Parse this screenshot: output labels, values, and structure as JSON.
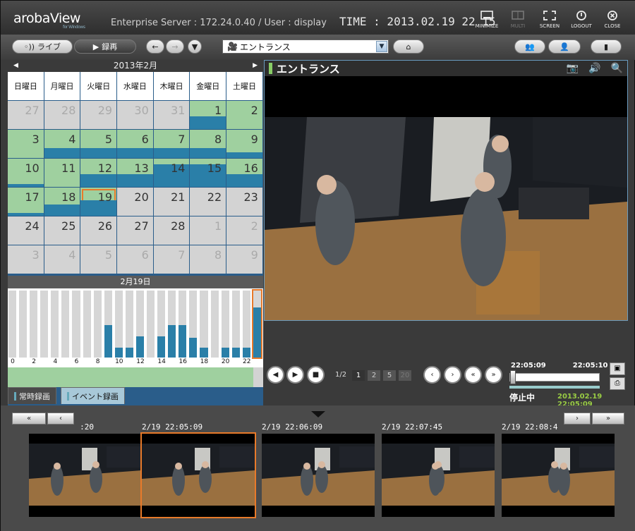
{
  "header": {
    "logo": "arobaView",
    "logo_sub": "for Windows",
    "server": "Enterprise Server : 172.24.0.40  /  User : display",
    "time": "TIME : 2013.02.19 22 15",
    "buttons": [
      {
        "label": "MINIMIZE",
        "icon": "minimize-icon",
        "enabled": true
      },
      {
        "label": "MULTI",
        "icon": "multi-icon",
        "enabled": false
      },
      {
        "label": "SCREEN",
        "icon": "fullscreen-icon",
        "enabled": true
      },
      {
        "label": "LOGOUT",
        "icon": "power-icon",
        "enabled": true
      },
      {
        "label": "CLOSE",
        "icon": "close-icon",
        "enabled": true
      }
    ]
  },
  "toolbar": {
    "live_label": "ライブ",
    "record_label": "録再",
    "camera_selected": "エントランス"
  },
  "calendar": {
    "month": "2013年2月",
    "dow": [
      "日曜日",
      "月曜日",
      "火曜日",
      "水曜日",
      "木曜日",
      "金曜日",
      "土曜日"
    ],
    "days": [
      {
        "d": "27",
        "other": true,
        "rec": false,
        "bar": 0
      },
      {
        "d": "28",
        "other": true,
        "rec": false,
        "bar": 0
      },
      {
        "d": "29",
        "other": true,
        "rec": false,
        "bar": 0
      },
      {
        "d": "30",
        "other": true,
        "rec": false,
        "bar": 0
      },
      {
        "d": "31",
        "other": true,
        "rec": false,
        "bar": 0
      },
      {
        "d": "1",
        "other": false,
        "rec": true,
        "bar": 0.45
      },
      {
        "d": "2",
        "other": false,
        "rec": true,
        "bar": 0.0
      },
      {
        "d": "3",
        "other": false,
        "rec": true,
        "bar": 0
      },
      {
        "d": "4",
        "other": false,
        "rec": true,
        "bar": 0.35
      },
      {
        "d": "5",
        "other": false,
        "rec": true,
        "bar": 0.35
      },
      {
        "d": "6",
        "other": false,
        "rec": true,
        "bar": 0.35
      },
      {
        "d": "7",
        "other": false,
        "rec": true,
        "bar": 0.35
      },
      {
        "d": "8",
        "other": false,
        "rec": true,
        "bar": 0.35
      },
      {
        "d": "9",
        "other": false,
        "rec": true,
        "bar": 0.2
      },
      {
        "d": "10",
        "other": false,
        "rec": true,
        "bar": 0.1
      },
      {
        "d": "11",
        "other": false,
        "rec": true,
        "bar": 0
      },
      {
        "d": "12",
        "other": false,
        "rec": true,
        "bar": 0.45
      },
      {
        "d": "13",
        "other": false,
        "rec": true,
        "bar": 0.45
      },
      {
        "d": "14",
        "other": false,
        "rec": true,
        "bar": 0.8
      },
      {
        "d": "15",
        "other": false,
        "rec": true,
        "bar": 0.8
      },
      {
        "d": "16",
        "other": false,
        "rec": true,
        "bar": 0.45
      },
      {
        "d": "17",
        "other": false,
        "rec": true,
        "bar": 0.1
      },
      {
        "d": "18",
        "other": false,
        "rec": true,
        "bar": 0.4
      },
      {
        "d": "19",
        "other": false,
        "rec": true,
        "bar": 0.55,
        "selected": true
      },
      {
        "d": "20",
        "other": false,
        "rec": false,
        "bar": 0
      },
      {
        "d": "21",
        "other": false,
        "rec": false,
        "bar": 0
      },
      {
        "d": "22",
        "other": false,
        "rec": false,
        "bar": 0
      },
      {
        "d": "23",
        "other": false,
        "rec": false,
        "bar": 0
      },
      {
        "d": "24",
        "other": false,
        "rec": false,
        "bar": 0
      },
      {
        "d": "25",
        "other": false,
        "rec": false,
        "bar": 0
      },
      {
        "d": "26",
        "other": false,
        "rec": false,
        "bar": 0
      },
      {
        "d": "27",
        "other": false,
        "rec": false,
        "bar": 0
      },
      {
        "d": "28",
        "other": false,
        "rec": false,
        "bar": 0
      },
      {
        "d": "1",
        "other": true,
        "rec": false,
        "bar": 0
      },
      {
        "d": "2",
        "other": true,
        "rec": false,
        "bar": 0
      },
      {
        "d": "3",
        "other": true,
        "rec": false,
        "bar": 0
      },
      {
        "d": "4",
        "other": true,
        "rec": false,
        "bar": 0
      },
      {
        "d": "5",
        "other": true,
        "rec": false,
        "bar": 0
      },
      {
        "d": "6",
        "other": true,
        "rec": false,
        "bar": 0
      },
      {
        "d": "7",
        "other": true,
        "rec": false,
        "bar": 0
      },
      {
        "d": "8",
        "other": true,
        "rec": false,
        "bar": 0
      },
      {
        "d": "9",
        "other": true,
        "rec": false,
        "bar": 0
      }
    ]
  },
  "hourly": {
    "date": "2月19日",
    "labels": [
      "0",
      "2",
      "4",
      "6",
      "8",
      "10",
      "12",
      "14",
      "16",
      "18",
      "20",
      "22"
    ],
    "levels": [
      0,
      0,
      0,
      0,
      0,
      0,
      0,
      0,
      0,
      0.48,
      0.15,
      0.15,
      0.32,
      0,
      0.32,
      0.48,
      0.48,
      0.3,
      0.15,
      0,
      0.15,
      0.15,
      0.15,
      0.75
    ]
  },
  "tabs": {
    "continuous": "常時録画",
    "event": "イベント録画"
  },
  "viewer": {
    "title": "エントランス"
  },
  "playback": {
    "page": "1/2",
    "pages": [
      "1",
      "2",
      "5",
      "20"
    ],
    "time_start": "22:05:09",
    "time_end": "22:05:10",
    "status": "停止中",
    "stamp": "2013.02.19 22:05:09"
  },
  "thumbnails": [
    {
      "label": ":20"
    },
    {
      "label": "2/19 22:05:09",
      "selected": true
    },
    {
      "label": "2/19 22:06:09"
    },
    {
      "label": "2/19 22:07:45"
    },
    {
      "label": "2/19 22:08:4"
    }
  ],
  "colors": {
    "recorded": "#9fd09f",
    "event_bar": "#2a7fa8",
    "selection": "#e87a2a",
    "accent": "#2a5d8a"
  }
}
